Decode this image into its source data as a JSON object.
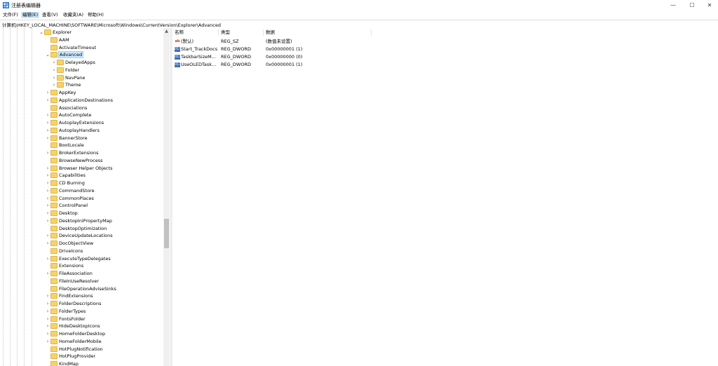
{
  "window": {
    "title": "注册表编辑器",
    "minimize": "—",
    "maximize": "☐",
    "close": "✕"
  },
  "menu": [
    {
      "label": "文件(F)",
      "active": false
    },
    {
      "label": "编辑(E)",
      "active": true
    },
    {
      "label": "查看(V)",
      "active": false
    },
    {
      "label": "收藏夹(A)",
      "active": false
    },
    {
      "label": "帮助(H)",
      "active": false
    }
  ],
  "address": "计算机\\HKEY_LOCAL_MACHINE\\SOFTWARE\\Microsoft\\Windows\\CurrentVersion\\Explorer\\Advanced",
  "tree": [
    {
      "label": "Explorer",
      "level": 0,
      "expander": "open",
      "selected": false
    },
    {
      "label": "AAM",
      "level": 1,
      "expander": "none",
      "selected": false
    },
    {
      "label": "ActivateTimeout",
      "level": 1,
      "expander": "none",
      "selected": false
    },
    {
      "label": "Advanced",
      "level": 1,
      "expander": "open",
      "selected": true
    },
    {
      "label": "DelayedApps",
      "level": 2,
      "expander": "closed",
      "selected": false
    },
    {
      "label": "Folder",
      "level": 2,
      "expander": "closed",
      "selected": false
    },
    {
      "label": "NavPane",
      "level": 2,
      "expander": "closed",
      "selected": false
    },
    {
      "label": "Theme",
      "level": 2,
      "expander": "closed",
      "selected": false
    },
    {
      "label": "AppKey",
      "level": 1,
      "expander": "closed",
      "selected": false
    },
    {
      "label": "ApplicationDestinations",
      "level": 1,
      "expander": "closed",
      "selected": false
    },
    {
      "label": "Associations",
      "level": 1,
      "expander": "none",
      "selected": false
    },
    {
      "label": "AutoComplete",
      "level": 1,
      "expander": "closed",
      "selected": false
    },
    {
      "label": "AutoplayExtensions",
      "level": 1,
      "expander": "closed",
      "selected": false
    },
    {
      "label": "AutoplayHandlers",
      "level": 1,
      "expander": "closed",
      "selected": false
    },
    {
      "label": "BannerStore",
      "level": 1,
      "expander": "closed",
      "selected": false
    },
    {
      "label": "BootLocale",
      "level": 1,
      "expander": "none",
      "selected": false
    },
    {
      "label": "BrokerExtensions",
      "level": 1,
      "expander": "closed",
      "selected": false
    },
    {
      "label": "BrowseNewProcess",
      "level": 1,
      "expander": "none",
      "selected": false
    },
    {
      "label": "Browser Helper Objects",
      "level": 1,
      "expander": "closed",
      "selected": false
    },
    {
      "label": "Capabilities",
      "level": 1,
      "expander": "closed",
      "selected": false
    },
    {
      "label": "CD Burning",
      "level": 1,
      "expander": "closed",
      "selected": false
    },
    {
      "label": "CommandStore",
      "level": 1,
      "expander": "closed",
      "selected": false
    },
    {
      "label": "CommonPlaces",
      "level": 1,
      "expander": "closed",
      "selected": false
    },
    {
      "label": "ControlPanel",
      "level": 1,
      "expander": "closed",
      "selected": false
    },
    {
      "label": "Desktop",
      "level": 1,
      "expander": "closed",
      "selected": false
    },
    {
      "label": "DesktopIniPropertyMap",
      "level": 1,
      "expander": "closed",
      "selected": false
    },
    {
      "label": "DesktopOptimization",
      "level": 1,
      "expander": "none",
      "selected": false
    },
    {
      "label": "DeviceUpdateLocations",
      "level": 1,
      "expander": "closed",
      "selected": false
    },
    {
      "label": "DocObjectView",
      "level": 1,
      "expander": "closed",
      "selected": false
    },
    {
      "label": "DriveIcons",
      "level": 1,
      "expander": "none",
      "selected": false
    },
    {
      "label": "ExecuteTypeDelegates",
      "level": 1,
      "expander": "closed",
      "selected": false
    },
    {
      "label": "Extensions",
      "level": 1,
      "expander": "none",
      "selected": false
    },
    {
      "label": "FileAssociation",
      "level": 1,
      "expander": "closed",
      "selected": false
    },
    {
      "label": "FileInUseResolver",
      "level": 1,
      "expander": "none",
      "selected": false
    },
    {
      "label": "FileOperationAdviseSinks",
      "level": 1,
      "expander": "none",
      "selected": false
    },
    {
      "label": "FindExtensions",
      "level": 1,
      "expander": "closed",
      "selected": false
    },
    {
      "label": "FolderDescriptions",
      "level": 1,
      "expander": "closed",
      "selected": false
    },
    {
      "label": "FolderTypes",
      "level": 1,
      "expander": "closed",
      "selected": false
    },
    {
      "label": "FontsFolder",
      "level": 1,
      "expander": "closed",
      "selected": false
    },
    {
      "label": "HideDesktopIcons",
      "level": 1,
      "expander": "closed",
      "selected": false
    },
    {
      "label": "HomeFolderDesktop",
      "level": 1,
      "expander": "closed",
      "selected": false
    },
    {
      "label": "HomeFolderMobile",
      "level": 1,
      "expander": "closed",
      "selected": false
    },
    {
      "label": "HotPlugNotification",
      "level": 1,
      "expander": "none",
      "selected": false
    },
    {
      "label": "HotPlugProvider",
      "level": 1,
      "expander": "none",
      "selected": false
    },
    {
      "label": "KindMap",
      "level": 1,
      "expander": "none",
      "selected": false
    }
  ],
  "list": {
    "headers": {
      "name": "名称",
      "type": "类型",
      "data": "数据"
    },
    "rows": [
      {
        "icon": "string-value-icon",
        "icon_glyph": "ab",
        "name": "(默认)",
        "type": "REG_SZ",
        "data": "(数值未设置)"
      },
      {
        "icon": "dword-value-icon",
        "icon_glyph": "011",
        "name": "Start_TrackDocs",
        "type": "REG_DWORD",
        "data": "0x00000001 (1)"
      },
      {
        "icon": "dword-value-icon",
        "icon_glyph": "011",
        "name": "TaskbarSizeM...",
        "type": "REG_DWORD",
        "data": "0x00000000 (0)"
      },
      {
        "icon": "dword-value-icon",
        "icon_glyph": "011",
        "name": "UseOLEDTask...",
        "type": "REG_DWORD",
        "data": "0x00000001 (1)"
      }
    ]
  },
  "colors": {
    "selection": "#cce8ff",
    "folder": "#f6d36a",
    "dword_icon": "#3a6fb5",
    "sz_icon": "#c0392b"
  }
}
